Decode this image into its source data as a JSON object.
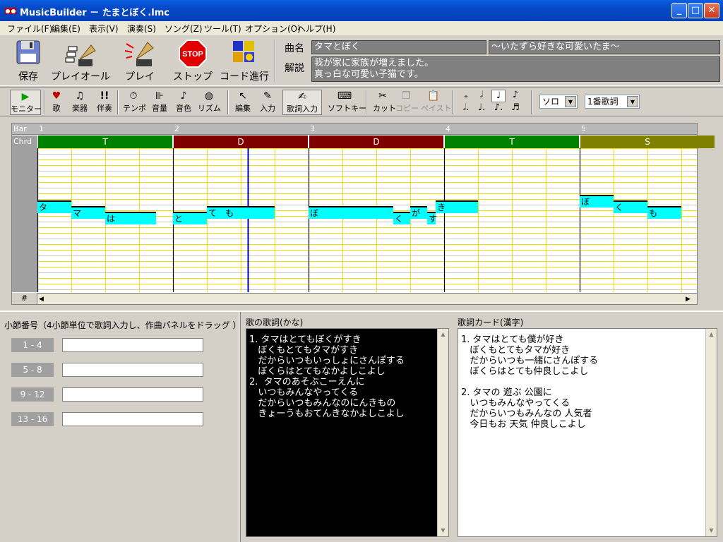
{
  "window": {
    "app_name": "MusicBuilder",
    "title": "MusicBuilder － たまとぼく.lmc"
  },
  "menu": [
    {
      "label": "ファイル(F)"
    },
    {
      "label": "編集(E)"
    },
    {
      "label": "表示(V)"
    },
    {
      "label": "演奏(S)"
    },
    {
      "label": "ソング(Z)"
    },
    {
      "label": "ツール(T)"
    },
    {
      "label": "オプション(O)"
    },
    {
      "label": "ヘルプ(H)"
    }
  ],
  "big_toolbar": {
    "save": "保存",
    "play_all": "プレイオール",
    "play": "プレイ",
    "stop": "ストップ",
    "stop_sign": "STOP",
    "chord_progress": "コード進行"
  },
  "song": {
    "title_label": "曲名",
    "title": "タマとぼく",
    "subtitle": "～いたずら好きな可愛いたま～",
    "desc_label": "解説",
    "desc_line1": "我が家に家族が増えました。",
    "desc_line2": "真っ白な可愛い子猫です。"
  },
  "small_toolbar": {
    "monitor": "モニター",
    "song": "歌",
    "instrument": "楽器",
    "accompaniment": "伴奏",
    "tempo": "テンポ",
    "volume": "音量",
    "tone": "音色",
    "rhythm": "リズム",
    "edit": "編集",
    "input": "入力",
    "lyric_input": "歌詞入力",
    "soft_key": "ソフトキー",
    "cut": "カット",
    "copy": "コピー",
    "paste": "ペイスト",
    "solo_select": "ソロ",
    "verse_select": "1番歌詞"
  },
  "score": {
    "bar_label": "Bar",
    "chord_label": "Chrd",
    "corner_label": "#",
    "bars": [
      "1",
      "2",
      "3",
      "4",
      "5"
    ],
    "chords": [
      {
        "name": "T",
        "color": "#008000"
      },
      {
        "name": "D",
        "color": "#800000"
      },
      {
        "name": "D",
        "color": "#800000"
      },
      {
        "name": "T",
        "color": "#008000"
      },
      {
        "name": "S",
        "color": "#808000"
      }
    ],
    "notes": [
      {
        "kana": "タ",
        "beat": 0,
        "len": 1,
        "pitch": 9
      },
      {
        "kana": "マ",
        "beat": 1,
        "len": 1,
        "pitch": 10
      },
      {
        "kana": "は",
        "beat": 2,
        "len": 1.5,
        "pitch": 11
      },
      {
        "kana": "と",
        "beat": 4,
        "len": 1,
        "pitch": 11
      },
      {
        "kana": "て",
        "beat": 5,
        "len": 0.5,
        "pitch": 10
      },
      {
        "kana": "も",
        "beat": 5.5,
        "len": 1.5,
        "pitch": 10
      },
      {
        "kana": "ぼ",
        "beat": 8,
        "len": 2.5,
        "pitch": 10
      },
      {
        "kana": "く",
        "beat": 10.5,
        "len": 0.5,
        "pitch": 11
      },
      {
        "kana": "が",
        "beat": 11,
        "len": 0.5,
        "pitch": 10
      },
      {
        "kana": "す",
        "beat": 11.5,
        "len": 0.25,
        "pitch": 11
      },
      {
        "kana": "き",
        "beat": 11.75,
        "len": 1.25,
        "pitch": 9
      },
      {
        "kana": "ぼ",
        "beat": 16,
        "len": 1,
        "pitch": 8
      },
      {
        "kana": "く",
        "beat": 17,
        "len": 1,
        "pitch": 9
      },
      {
        "kana": "も",
        "beat": 18,
        "len": 1,
        "pitch": 10
      }
    ]
  },
  "measure_panel": {
    "label": "小節番号（4小節単位で歌詞入力し、作曲パネルをドラッグ ）",
    "ranges": [
      "1 - 4",
      "5 - 8",
      "9 - 12",
      "13 - 16"
    ]
  },
  "kana_panel": {
    "label": "歌の歌詞(かな)",
    "lines": [
      "1. タマはとてもぼくがすき",
      "   ぼくもとてもタマがすき",
      "   だからいつもいっしょにさんぽする",
      "   ぼくらはとてもなかよしこよし",
      "2.  タマのあそぶこーえんに",
      "   いつもみんなやってくる",
      "   だからいつもみんなのにんきもの",
      "   きょーうもおてんきなかよしこよし"
    ]
  },
  "kanji_panel": {
    "label": "歌詞カード(漢字)",
    "lines": [
      "1. タマはとても僕が好き",
      "   ぼくもとてもタマが好き",
      "   だからいつも一緒にさんぽする",
      "   ぼくらはとても仲良しこよし",
      "",
      "2. タマの 遊ぶ 公園に",
      "   いつもみんなやってくる",
      "   だからいつもみんなの 人気者",
      "   今日もお 天気 仲良しこよし"
    ]
  }
}
